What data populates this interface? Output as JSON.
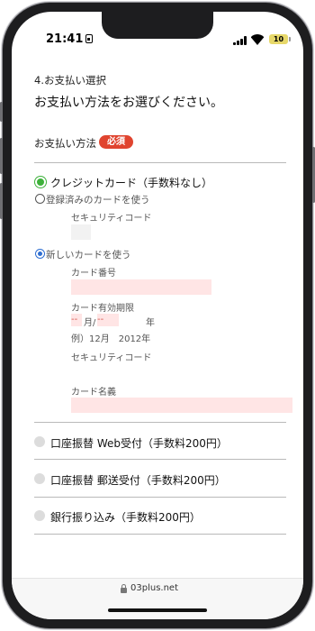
{
  "status": {
    "time": "21:41",
    "battery": "10"
  },
  "page": {
    "step_title": "4.お支払い選択",
    "heading": "お支払い方法をお選びください。",
    "payment_label": "お支払い方法",
    "required_badge": "必須"
  },
  "options": {
    "credit": {
      "label": "クレジットカード（手数料なし）",
      "selected": true
    },
    "registered_card": {
      "label": "登録済みのカードを使う",
      "security_code_label": "セキュリティコード"
    },
    "new_card": {
      "label": "新しいカードを使う",
      "selected": true,
      "card_number_label": "カード番号",
      "expiry_label": "カード有効期限",
      "expiry_month_value": "--",
      "expiry_month_unit": "月/",
      "expiry_year_value": "--",
      "expiry_year_unit": "年",
      "expiry_example": "例）12月　2012年",
      "security_code_label": "セキュリティコード",
      "card_name_label": "カード名義"
    },
    "web_transfer": {
      "label": "口座振替 Web受付（手数料200円）"
    },
    "mail_transfer": {
      "label": "口座振替 郵送受付（手数料200円）"
    },
    "bank_transfer": {
      "label": "銀行振り込み（手数料200円）"
    }
  },
  "browser": {
    "url": "03plus.net"
  },
  "colors": {
    "required": "#e0442f",
    "selected_radio": "#3db13a",
    "sub_radio": "#2f6ed1",
    "input_bg": "#ffe5e5"
  }
}
